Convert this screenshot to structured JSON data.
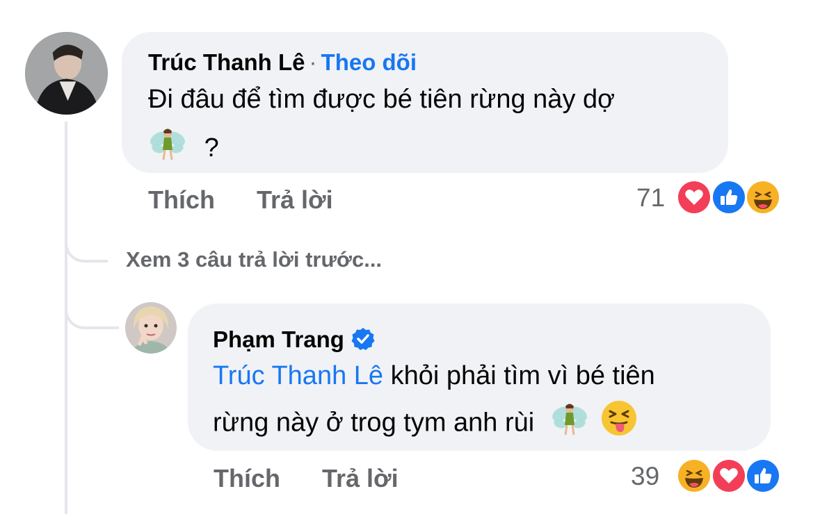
{
  "comment1": {
    "author": "Trúc Thanh Lê",
    "separator": "·",
    "follow": "Theo dõi",
    "text_line1": "Đi đâu để tìm được bé tiên rừng này dợ",
    "text_line2": "?",
    "like": "Thích",
    "reply": "Trả lời",
    "reaction_count": "71",
    "reactions": [
      "love",
      "like",
      "haha"
    ]
  },
  "view_previous": "Xem 3 câu trả lời trước...",
  "reply1": {
    "author": "Phạm Trang",
    "verified": true,
    "mention": "Trúc Thanh Lê",
    "text_line1": " khỏi phải tìm vì bé tiên",
    "text_line2": "rừng này ở trog tym anh rùi",
    "like": "Thích",
    "reply": "Trả lời",
    "reaction_count": "39",
    "reactions": [
      "haha",
      "love",
      "like"
    ]
  },
  "colors": {
    "bubble": "#f0f2f5",
    "link": "#1877f2",
    "secondary": "#65676b",
    "love": "#f33e58",
    "like": "#1877f2",
    "haha": "#f7b125"
  }
}
